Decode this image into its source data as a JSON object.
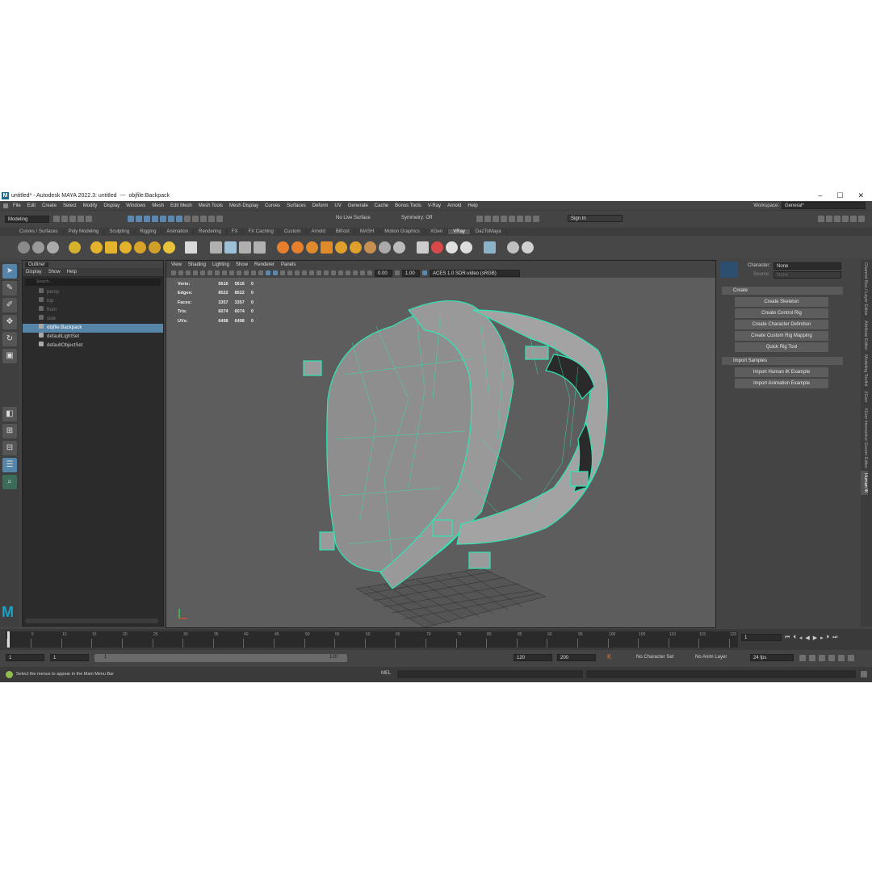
{
  "title": {
    "doc": "untitled* - Autodesk MAYA 2022.3: untitled",
    "sep": "---",
    "obj": "objfile:Backpack"
  },
  "menu": [
    "File",
    "Edit",
    "Create",
    "Select",
    "Modify",
    "Display",
    "Windows",
    "Mesh",
    "Edit Mesh",
    "Mesh Tools",
    "Mesh Display",
    "Curves",
    "Surfaces",
    "Deform",
    "UV",
    "Generate",
    "Cache",
    "Bonus Tools",
    "V-Ray",
    "Arnold",
    "Help"
  ],
  "workspace": {
    "label": "Workspace:",
    "value": "General*"
  },
  "status": {
    "mode": "Modeling",
    "live": "No Live Surface",
    "symmetry": "Symmetry: Off",
    "signin": "Sign In"
  },
  "shelf_tabs": [
    "Curves / Surfaces",
    "Poly Modeling",
    "Sculpting",
    "Rigging",
    "Animation",
    "Rendering",
    "FX",
    "FX Caching",
    "Custom",
    "Arnold",
    "Bifrost",
    "MASH",
    "Motion Graphics",
    "XGen",
    "VRay",
    "DazToMaya"
  ],
  "shelf_active": "VRay",
  "outliner": {
    "tab": "Outliner",
    "menu": [
      "Display",
      "Show",
      "Help"
    ],
    "search": "Search...",
    "items": [
      {
        "label": "persp",
        "dim": true
      },
      {
        "label": "top",
        "dim": true
      },
      {
        "label": "front",
        "dim": true
      },
      {
        "label": "side",
        "dim": true
      },
      {
        "label": "objfile:Backpack",
        "sel": true
      },
      {
        "label": "defaultLightSet"
      },
      {
        "label": "defaultObjectSet"
      }
    ]
  },
  "viewport": {
    "menu": [
      "View",
      "Shading",
      "Lighting",
      "Show",
      "Renderer",
      "Panels"
    ],
    "exposure": "0.00",
    "gamma": "1.00",
    "colorspace": "ACES 1.0 SDR-video (sRGB)",
    "hud": [
      [
        "Verts:",
        "5616",
        "5616",
        "0"
      ],
      [
        "Edges:",
        "8522",
        "8522",
        "0"
      ],
      [
        "Faces:",
        "3357",
        "3357",
        "0"
      ],
      [
        "Tris:",
        "6074",
        "6074",
        "0"
      ],
      [
        "UVs:",
        "6498",
        "6498",
        "0"
      ]
    ]
  },
  "hik": {
    "character_label": "Character:",
    "character": "None",
    "source_label": "Source:",
    "source": "None",
    "create": "Create",
    "buttons": [
      "Create Skeleton",
      "Create Control Rig",
      "Create Character Definition",
      "Create Custom Rig Mapping",
      "Quick Rig Tool"
    ],
    "samples": "Import Samples",
    "sample_buttons": [
      "Import Human IK Example",
      "Import Animation Example"
    ]
  },
  "side_tabs": [
    "Channel Box / Layer Editor",
    "Attribute Editor",
    "Modeling Toolkit",
    "XGen",
    "XGen Interactive Groom Editor",
    "Human IK"
  ],
  "timeline": {
    "ticks": [
      "1",
      "5",
      "10",
      "15",
      "20",
      "25",
      "30",
      "35",
      "40",
      "45",
      "50",
      "55",
      "60",
      "65",
      "70",
      "75",
      "80",
      "85",
      "90",
      "95",
      "100",
      "105",
      "110",
      "115",
      "120"
    ],
    "current": "1"
  },
  "range": {
    "start": "1",
    "start2": "1",
    "slider_start": "1",
    "slider_end": "120",
    "end": "120",
    "end2": "200",
    "charset": "No Character Set",
    "animlayer": "No Anim Layer",
    "fps": "24 fps"
  },
  "cmd": {
    "help": "Select the menus to appear in the Main Menu Bar",
    "mel": "MEL"
  }
}
